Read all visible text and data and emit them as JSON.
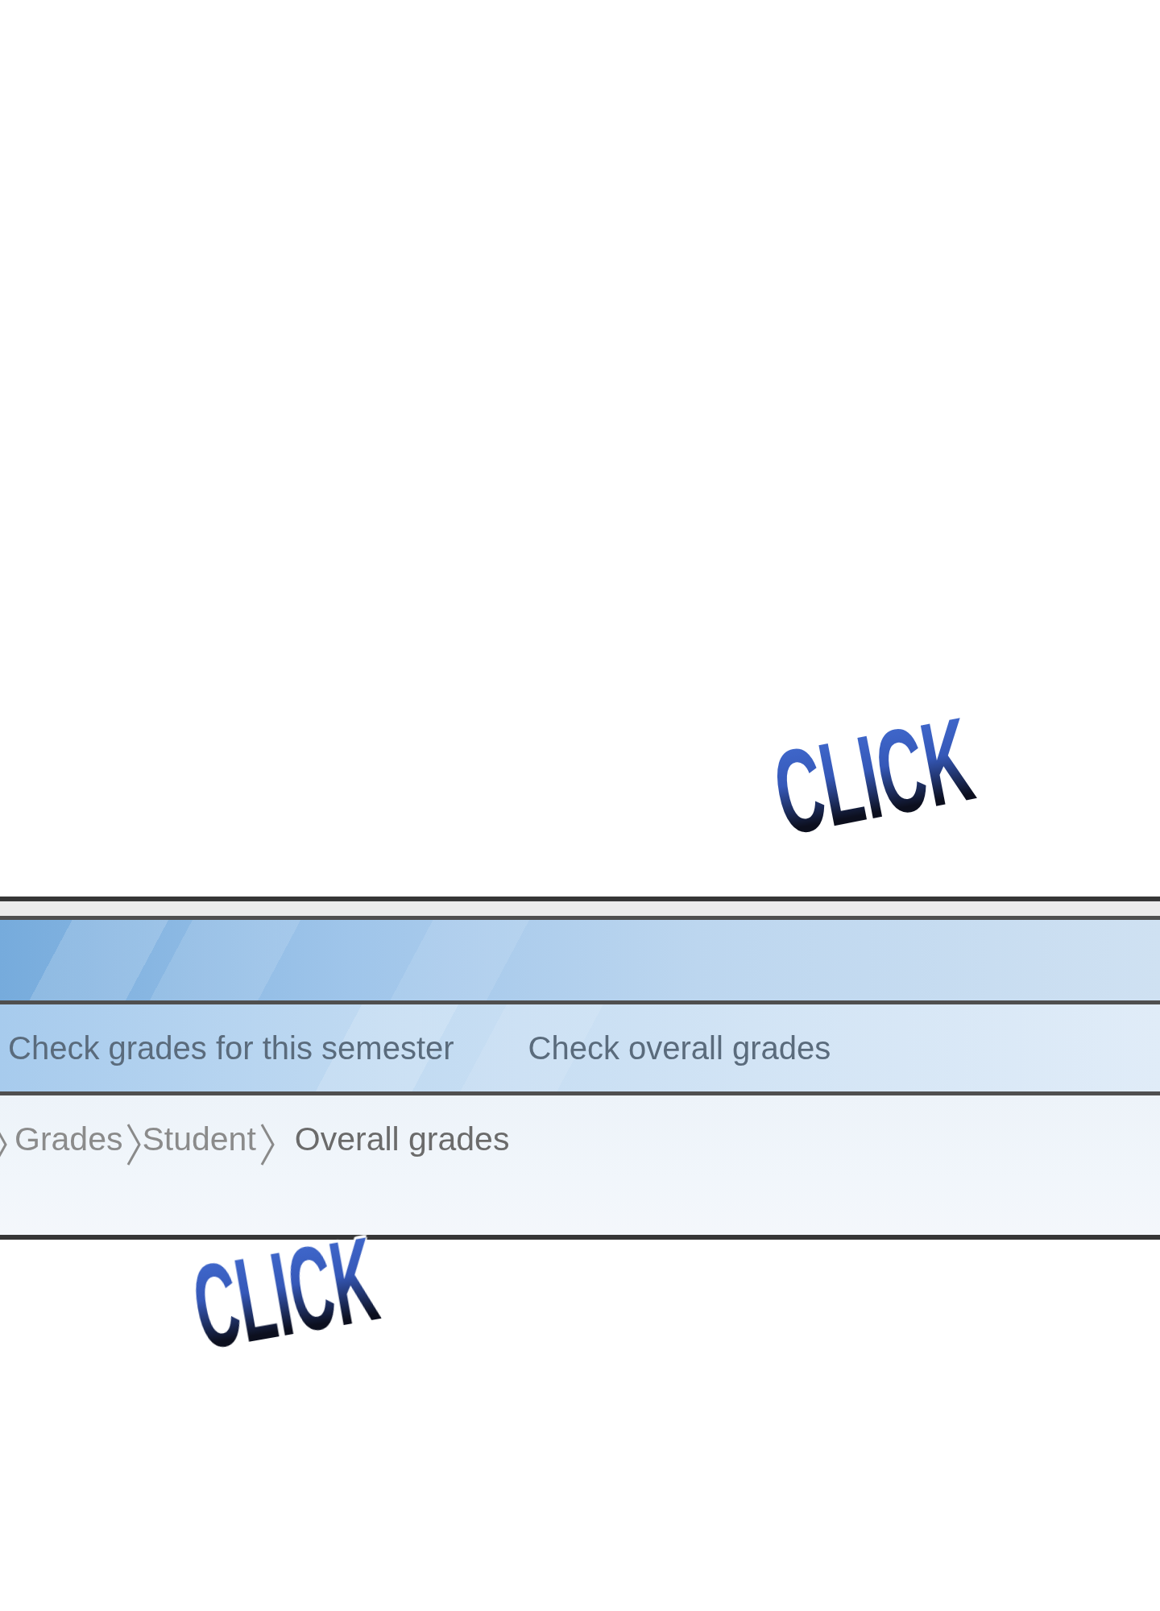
{
  "sound_effect_above": {
    "text": "CLICK"
  },
  "panel": {
    "menu": [
      {
        "label": "Check grades for this semester"
      },
      {
        "label": "Check overall grades"
      }
    ],
    "breadcrumb": [
      {
        "label": "Grades",
        "current": false
      },
      {
        "label": "Student",
        "current": false
      },
      {
        "label": "Overall grades",
        "current": true
      }
    ]
  },
  "sound_effect_below": {
    "text": "CLICK"
  }
}
